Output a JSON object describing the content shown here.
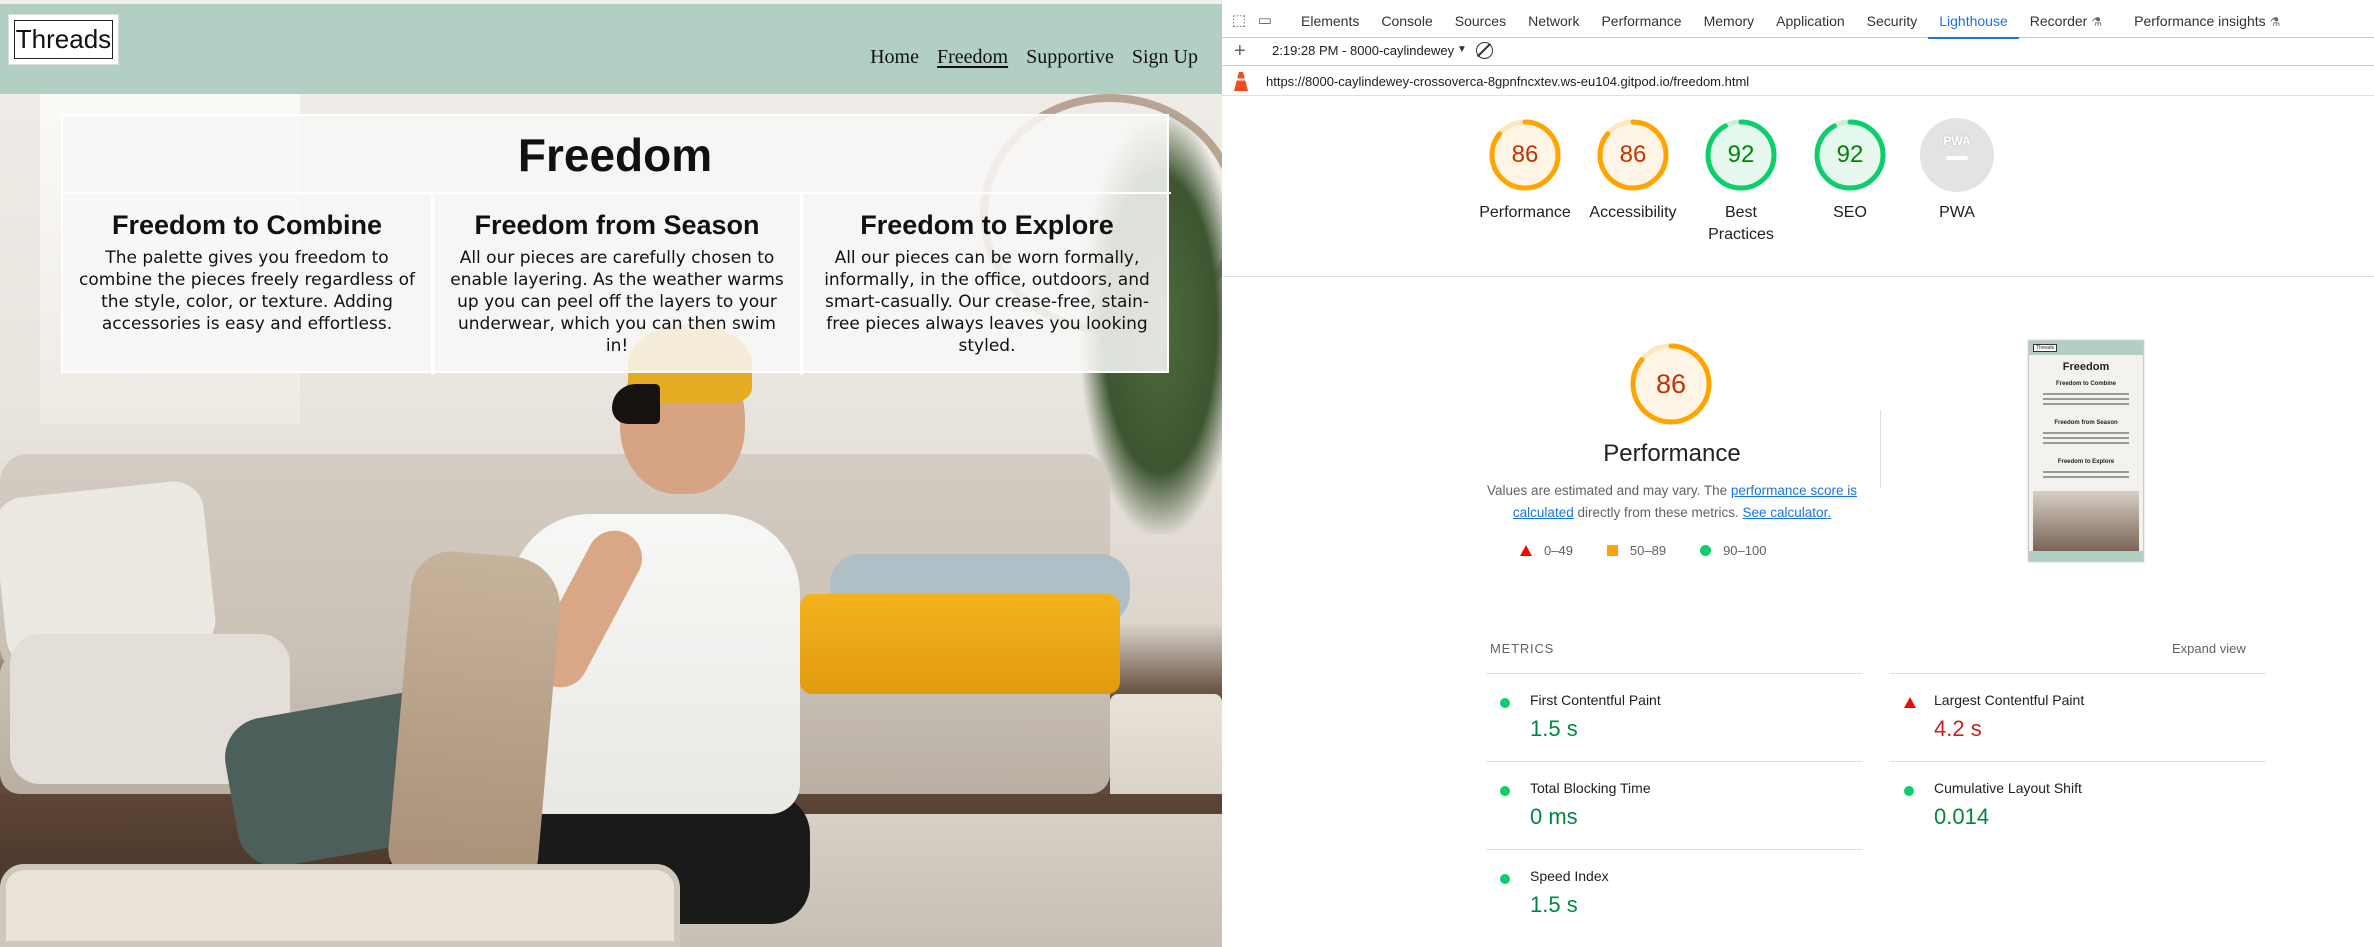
{
  "site": {
    "logo": "Threads",
    "nav": [
      {
        "label": "Home"
      },
      {
        "label": "Freedom"
      },
      {
        "label": "Supportive"
      },
      {
        "label": "Sign Up"
      }
    ],
    "title": "Freedom",
    "columns": [
      {
        "heading": "Freedom to Combine",
        "text": "The palette gives you freedom to combine the pieces freely regardless of the style, color, or texture. Adding accessories is easy and effortless."
      },
      {
        "heading": "Freedom from Season",
        "text": "All our pieces are carefully chosen to enable layering. As the weather warms up you can peel off the layers to your underwear, which you can then swim in!"
      },
      {
        "heading": "Freedom to Explore",
        "text": "All our pieces can be worn formally, informally, in the office, outdoors, and smart-casually. Our crease-free, stain-free pieces always leaves you looking styled."
      }
    ]
  },
  "devtools": {
    "tabs": [
      "Elements",
      "Console",
      "Sources",
      "Network",
      "Performance",
      "Memory",
      "Application",
      "Security",
      "Lighthouse",
      "Recorder",
      "Performance insights"
    ],
    "active_tab": "Lighthouse",
    "report_select": "2:19:28 PM - 8000-caylindewey",
    "url": "https://8000-caylindewey-crossoverca-8gpnfncxtev.ws-eu104.gitpod.io/freedom.html",
    "scores": [
      {
        "label": "Performance",
        "value": "86",
        "fraction": 0.86,
        "color": "#ffa400"
      },
      {
        "label": "Accessibility",
        "value": "86",
        "fraction": 0.86,
        "color": "#ffa400"
      },
      {
        "label": "Best Practices",
        "value": "92",
        "fraction": 0.92,
        "color": "#0cce6b"
      },
      {
        "label": "SEO",
        "value": "92",
        "fraction": 0.92,
        "color": "#0cce6b"
      },
      {
        "label": "PWA",
        "value": "PWA"
      }
    ],
    "performance": {
      "score": "86",
      "title": "Performance",
      "desc_prefix": "Values are estimated and may vary. The ",
      "desc_link1": "performance score is calculated",
      "desc_mid": " directly from these metrics. ",
      "desc_link2": "See calculator.",
      "legend": [
        "0–49",
        "50–89",
        "90–100"
      ]
    },
    "thumbnail": {
      "logo": "Threads",
      "title": "Freedom",
      "headings": [
        "Freedom to Combine",
        "Freedom from Season",
        "Freedom to Explore"
      ]
    },
    "metrics_header": "METRICS",
    "expand_view": "Expand view",
    "metrics": [
      {
        "name": "First Contentful Paint",
        "value": "1.5 s",
        "status": "good"
      },
      {
        "name": "Largest Contentful Paint",
        "value": "4.2 s",
        "status": "poor"
      },
      {
        "name": "Total Blocking Time",
        "value": "0 ms",
        "status": "good"
      },
      {
        "name": "Cumulative Layout Shift",
        "value": "0.014",
        "status": "good"
      },
      {
        "name": "Speed Index",
        "value": "1.5 s",
        "status": "good"
      }
    ]
  }
}
